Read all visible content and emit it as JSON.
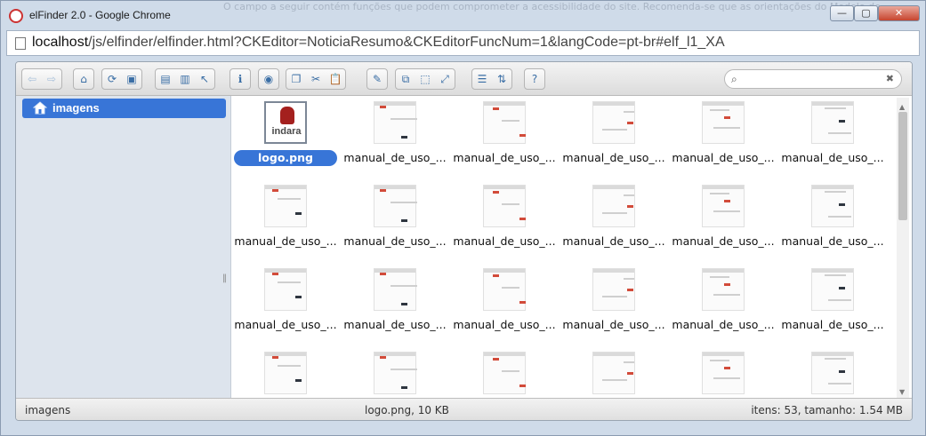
{
  "browser": {
    "window_title": "elFinder 2.0 - Google Chrome",
    "background_text": "O campo a seguir contém funções que podem comprometer a acessibilidade do site. Recomenda-se que as orientações do Modelo de",
    "url_host": "localhost",
    "url_rest": "/js/elfinder/elfinder.html?CKEditor=NoticiaResumo&CKEditorFuncNum=1&langCode=pt-br#elf_l1_XA",
    "min_label": "—",
    "max_label": "▢",
    "close_label": "✕"
  },
  "toolbar": {
    "groups": [
      {
        "icons": [
          "back-icon",
          "forward-icon"
        ],
        "glyphs": [
          "⇦",
          "⇨"
        ],
        "disabled": [
          true,
          true
        ]
      },
      {
        "icons": [
          "home-icon"
        ],
        "glyphs": [
          "⌂"
        ],
        "disabled": [
          false
        ]
      },
      {
        "icons": [
          "reload-icon",
          "save-icon"
        ],
        "glyphs": [
          "⟳",
          "▣"
        ],
        "disabled": [
          false,
          false
        ]
      },
      {
        "icons": [
          "open-icon",
          "download-icon",
          "select-icon"
        ],
        "glyphs": [
          "▤",
          "▥",
          "↖"
        ],
        "disabled": [
          false,
          false,
          false
        ]
      },
      {
        "icons": [
          "info-icon"
        ],
        "glyphs": [
          "ℹ"
        ],
        "disabled": [
          false
        ]
      },
      {
        "icons": [
          "preview-icon"
        ],
        "glyphs": [
          "◉"
        ],
        "disabled": [
          false
        ]
      },
      {
        "icons": [
          "copy-icon",
          "cut-icon",
          "paste-icon"
        ],
        "glyphs": [
          "❐",
          "✂",
          "📋"
        ],
        "disabled": [
          false,
          false,
          true
        ]
      },
      {
        "icons": [
          "edit-icon"
        ],
        "glyphs": [
          "✎"
        ],
        "disabled": [
          false
        ]
      },
      {
        "icons": [
          "duplicate-icon",
          "crop-icon",
          "resize-icon"
        ],
        "glyphs": [
          "⧉",
          "⬚",
          "⤢"
        ],
        "disabled": [
          false,
          false,
          false
        ]
      },
      {
        "icons": [
          "list-view-icon",
          "sort-icon"
        ],
        "glyphs": [
          "☰",
          "⇅"
        ],
        "disabled": [
          false,
          false
        ]
      },
      {
        "icons": [
          "help-icon"
        ],
        "glyphs": [
          "?"
        ],
        "disabled": [
          false
        ]
      }
    ],
    "search_placeholder": "",
    "search_value": "",
    "search_icon": "⌕",
    "clear_icon": "✖"
  },
  "navbar": {
    "root_label": "imagens",
    "resize_glyph": "‖"
  },
  "files": [
    {
      "name": "logo.png",
      "kind": "logo",
      "selected": true,
      "logo_text": "indara"
    },
    {
      "name": "manual_de_uso_...",
      "kind": "doc"
    },
    {
      "name": "manual_de_uso_...",
      "kind": "doc"
    },
    {
      "name": "manual_de_uso_...",
      "kind": "doc"
    },
    {
      "name": "manual_de_uso_...",
      "kind": "doc"
    },
    {
      "name": "manual_de_uso_...",
      "kind": "doc"
    },
    {
      "name": "manual_de_uso_...",
      "kind": "doc"
    },
    {
      "name": "manual_de_uso_...",
      "kind": "doc"
    },
    {
      "name": "manual_de_uso_...",
      "kind": "doc"
    },
    {
      "name": "manual_de_uso_...",
      "kind": "doc"
    },
    {
      "name": "manual_de_uso_...",
      "kind": "doc"
    },
    {
      "name": "manual_de_uso_...",
      "kind": "doc"
    },
    {
      "name": "manual_de_uso_...",
      "kind": "doc"
    },
    {
      "name": "manual_de_uso_...",
      "kind": "doc"
    },
    {
      "name": "manual_de_uso_...",
      "kind": "doc"
    },
    {
      "name": "manual_de_uso_...",
      "kind": "doc"
    },
    {
      "name": "manual_de_uso_...",
      "kind": "doc"
    },
    {
      "name": "manual_de_uso_...",
      "kind": "doc"
    },
    {
      "name": "",
      "kind": "doc"
    },
    {
      "name": "",
      "kind": "doc"
    },
    {
      "name": "",
      "kind": "doc"
    },
    {
      "name": "",
      "kind": "doc"
    },
    {
      "name": "",
      "kind": "doc"
    },
    {
      "name": "",
      "kind": "doc"
    }
  ],
  "scrollbar": {
    "up": "▲",
    "down": "▼"
  },
  "status": {
    "path": "imagens",
    "selected": "logo.png, 10 KB",
    "summary": "itens: 53, tamanho: 1.54 MB"
  },
  "colors": {
    "selection": "#3875d7",
    "accent_red": "#d24b3a"
  }
}
